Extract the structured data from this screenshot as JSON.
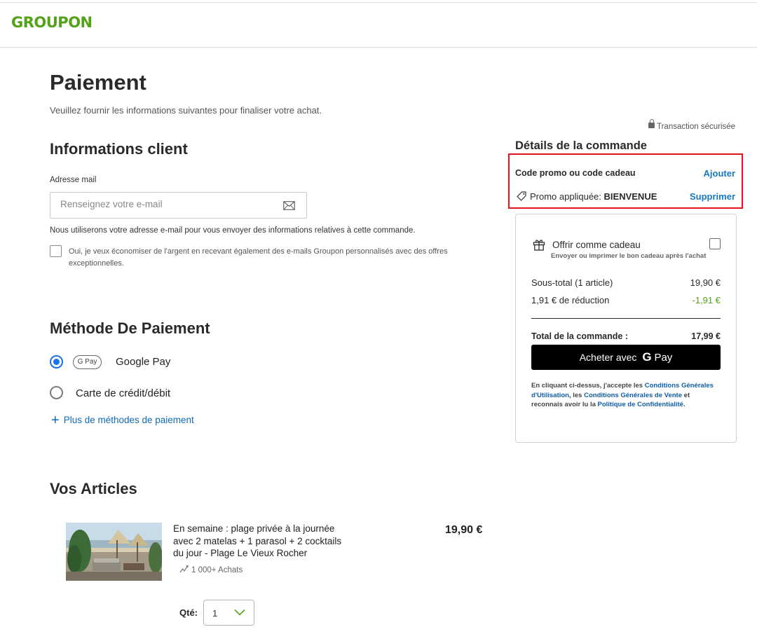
{
  "brand": {
    "logo_text": "GROUPON",
    "color": "#53a318"
  },
  "page": {
    "title": "Paiement",
    "subtitle": "Veuillez fournir les informations suivantes pour finaliser votre achat."
  },
  "customer": {
    "section_title": "Informations client",
    "email_label": "Adresse mail",
    "email_placeholder": "Renseignez votre e-mail",
    "email_value": "",
    "email_icon": "envelope-icon",
    "email_note": "Nous utiliserons votre adresse e-mail pour vous envoyer des informations relatives à cette commande.",
    "optin_text": "Oui, je veux économiser de l'argent en recevant également des e-mails Groupon personnalisés avec des offres exceptionnelles.",
    "optin_checked": false
  },
  "payment": {
    "section_title": "Méthode De Paiement",
    "methods": [
      {
        "badge": "G Pay",
        "label": "Google Pay",
        "selected": true
      },
      {
        "label": "Carte de crédit/débit",
        "selected": false
      }
    ],
    "more_label": "Plus de méthodes de paiement",
    "accent": "#1a73e8"
  },
  "order": {
    "secure_label": "Transaction sécurisée",
    "title": "Détails de la commande",
    "promo_label": "Code promo ou code cadeau",
    "promo_add": "Ajouter",
    "promo_applied_label": "Promo appliquée:",
    "promo_code": "BIENVENUE",
    "promo_remove": "Supprimer",
    "highlight_color": "#e2131b",
    "gift_title": "Offrir comme cadeau",
    "gift_sub": "Envoyer ou imprimer le bon cadeau après l'achat",
    "gift_checked": false,
    "subtotal_label": "Sous-total (1 article)",
    "subtotal_value": "19,90 €",
    "discount_label": "1,91 € de réduction",
    "discount_value": "-1,91 €",
    "total_label": "Total de la commande :",
    "total_value": "17,99 €",
    "buy_label": "Acheter avec",
    "buy_g": "G",
    "buy_pay": "Pay",
    "legal": {
      "t1": "En cliquant ci-dessus, j'accepte les ",
      "l1": "Conditions Générales d'Utilisation",
      "t2": ", les ",
      "l2": "Conditions Générales de Vente",
      "t3": " et reconnais avoir lu la ",
      "l3": "Politique de Confidentialité",
      "t4": "."
    }
  },
  "items": {
    "section_title": "Vos Articles",
    "list": [
      {
        "title": "En semaine : plage privée à la journée avec 2 matelas + 1 parasol + 2 cocktails du jour - Plage Le Vieux Rocher",
        "purchases": "1 000+ Achats",
        "price": "19,90 €",
        "qty_label": "Qté:",
        "qty": "1"
      }
    ]
  }
}
